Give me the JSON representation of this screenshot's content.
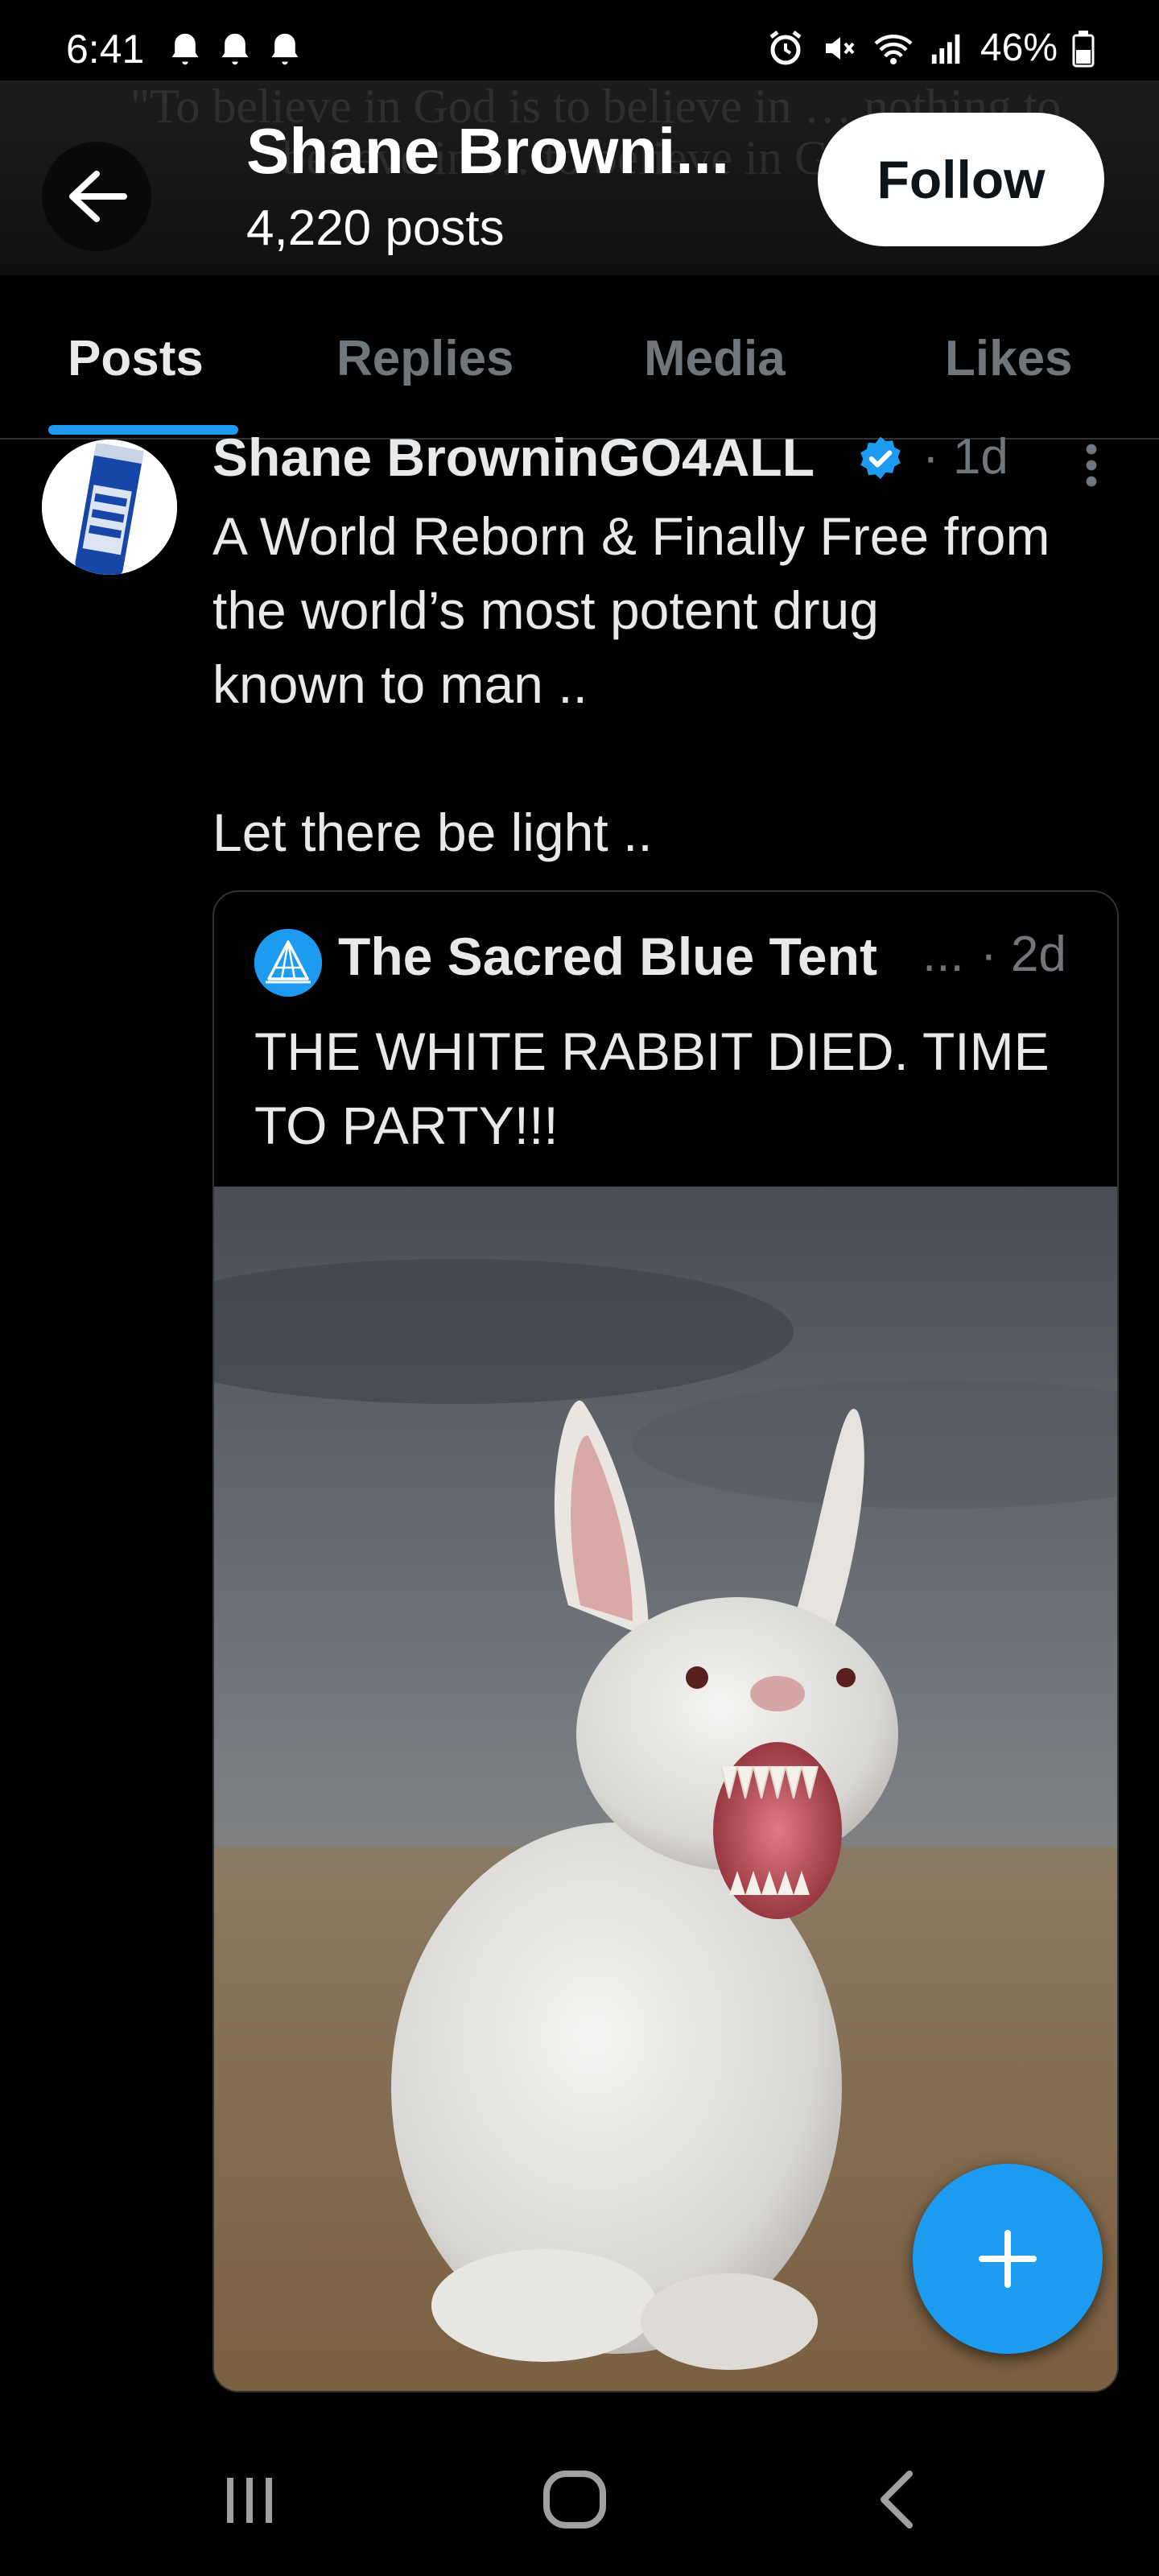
{
  "status_bar": {
    "time": "6:41",
    "battery": "46%",
    "icons": [
      "bell-icon",
      "bell-icon",
      "bell-icon",
      "alarm-icon",
      "mute-icon",
      "wifi-icon",
      "signal-icon",
      "battery-icon"
    ]
  },
  "header": {
    "banner_text": "\"To believe in God is to believe in … nothing to believe in … to believe in God.\"",
    "name": "Shane Browni...",
    "post_count": "4,220 posts",
    "follow_label": "Follow"
  },
  "tabs": [
    {
      "label": "Posts",
      "active": true
    },
    {
      "label": "Replies",
      "active": false
    },
    {
      "label": "Media",
      "active": false
    },
    {
      "label": "Likes",
      "active": false
    }
  ],
  "post": {
    "author": "Shane BrowninGO4ALL",
    "time": "· 1d",
    "text_lines": [
      "A World Reborn & Finally Free from",
      "the world’s most potent drug",
      "known to man ..",
      "Let there be light .."
    ],
    "quote": {
      "author": "The Sacred Blue Tent",
      "ellipsis": "...",
      "time": "· 2d",
      "text_lines": [
        "THE WHITE RABBIT DIED. TIME",
        "TO PARTY!!!"
      ]
    }
  },
  "colors": {
    "accent": "#1d9bf0",
    "background": "#000000",
    "text_primary": "#e7e9ea",
    "text_secondary": "#71767b",
    "border": "#2f3336"
  }
}
